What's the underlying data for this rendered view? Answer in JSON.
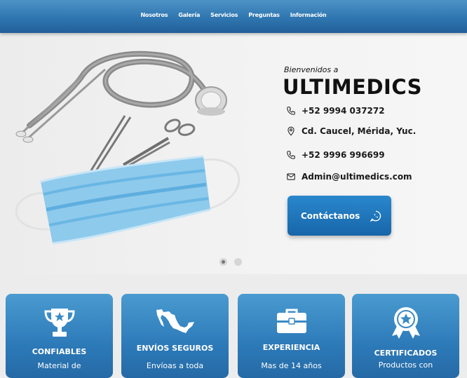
{
  "nav": {
    "items": [
      "Nosotros",
      "Galería",
      "Servicios",
      "Preguntas",
      "Información"
    ]
  },
  "hero": {
    "welcome": "Bienvenidos a",
    "brand": "ULTIMEDICS",
    "contacts": [
      {
        "icon": "phone-icon",
        "text": "+52 9994 037272"
      },
      {
        "icon": "location-pin-icon",
        "text": "Cd. Caucel, Mérida, Yuc."
      },
      {
        "icon": "phone-icon",
        "text": "+52 9996 996699"
      },
      {
        "icon": "envelope-icon",
        "text": "Admin@ultimedics.com"
      }
    ],
    "cta_label": "Contáctanos",
    "cta_icon": "whatsapp-icon"
  },
  "slider": {
    "slides": 2,
    "active": 1
  },
  "features": [
    {
      "icon": "trophy-icon",
      "title": "CONFIABLES",
      "desc": "Material de"
    },
    {
      "icon": "mexico-map-icon",
      "title": "ENVÍOS SEGUROS",
      "desc": "Envíoas a toda"
    },
    {
      "icon": "briefcase-icon",
      "title": "EXPERIENCIA",
      "desc": "Mas de 14 años"
    },
    {
      "icon": "certificate-ribbon-icon",
      "title": "CERTIFICADOS",
      "desc": "Productos con"
    }
  ],
  "colors": {
    "nav_gradient_top": "#4d93c7",
    "nav_gradient_bottom": "#225f98",
    "cta": "#1f78be",
    "card": "#3a8ac4",
    "mask": "#8fc8ea"
  }
}
